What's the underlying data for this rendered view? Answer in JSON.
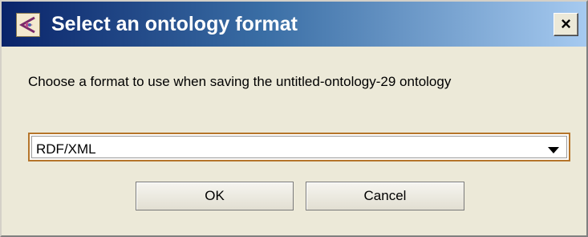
{
  "window": {
    "title": "Select an ontology format",
    "icon": "protege-logo-icon",
    "close_label": "×"
  },
  "message": "Choose a format to use when saving the untitled-ontology-29 ontology",
  "format_select": {
    "selected": "RDF/XML"
  },
  "buttons": {
    "ok_label": "OK",
    "cancel_label": "Cancel"
  },
  "colors": {
    "titlebar_start": "#0a246a",
    "titlebar_end": "#a6caf0",
    "dialog_bg": "#ece9d8",
    "focus_border": "#b5752a"
  }
}
